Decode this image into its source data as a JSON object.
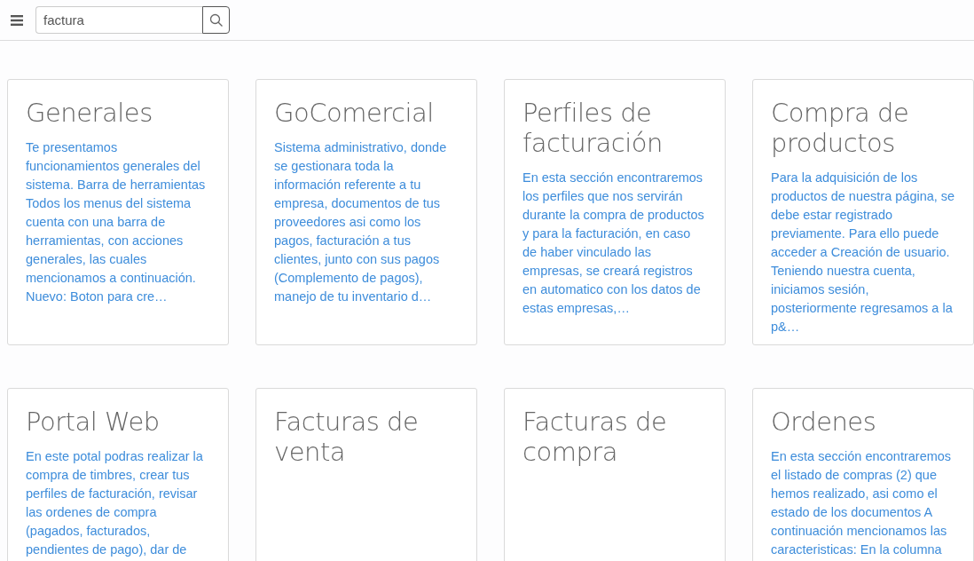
{
  "search": {
    "value": "factura"
  },
  "cards": [
    {
      "title": "Generales",
      "text": "Te presentamos funcionamientos generales del sistema. Barra de herramientas Todos los menus del sistema cuenta con una barra de herramientas, con acciones generales, las cuales mencionamos a continuación. Nuevo: Boton para cre…"
    },
    {
      "title": "GoComercial",
      "text": "Sistema administrativo, donde se gestionara toda la información referente a tu empresa, documentos de tus proveedores asi como los pagos, facturación a tus clientes, junto con sus pagos (Complemento de pagos), manejo de tu inventario d…"
    },
    {
      "title": "Perfiles de facturación",
      "text": "En esta sección encontraremos los perfiles que nos servirán durante la compra de productos y para la facturación, en caso de haber vinculado las empresas, se creará registros en automatico con los datos de estas empresas,…"
    },
    {
      "title": "Compra de productos",
      "text": "Para la adquisición de los productos de nuestra página, se debe estar registrado previamente. Para ello puede acceder a Creación de usuario. Teniendo nuestra cuenta, iniciamos sesión, posteriormente regresamos a la p&…"
    },
    {
      "title": "Portal Web",
      "text": "En este potal podras realizar la compra de timbres, crear tus perfiles de facturación, revisar las ordenes de compra (pagados, facturados, pendientes de pago), dar de"
    },
    {
      "title": "Facturas de venta"
    },
    {
      "title": "Facturas de compra"
    },
    {
      "title": "Ordenes",
      "text": "En esta sección encontraremos el listado de compras (2) que hemos realizado, asi como el estado de los documentos A continuación mencionamos las caracteristicas: En la columna"
    }
  ]
}
